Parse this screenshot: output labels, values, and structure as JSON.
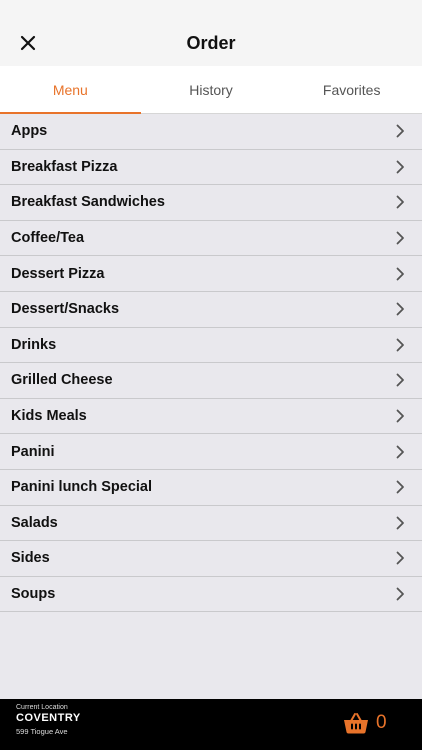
{
  "header": {
    "title": "Order",
    "close_icon": "close-icon"
  },
  "tabs": [
    {
      "label": "Menu",
      "active": true
    },
    {
      "label": "History",
      "active": false
    },
    {
      "label": "Favorites",
      "active": false
    }
  ],
  "menu": {
    "items": [
      {
        "label": "Apps"
      },
      {
        "label": "Breakfast Pizza"
      },
      {
        "label": "Breakfast Sandwiches"
      },
      {
        "label": "Coffee/Tea"
      },
      {
        "label": "Dessert Pizza"
      },
      {
        "label": "Dessert/Snacks"
      },
      {
        "label": "Drinks"
      },
      {
        "label": "Grilled Cheese"
      },
      {
        "label": "Kids Meals"
      },
      {
        "label": "Panini"
      },
      {
        "label": "Panini lunch Special"
      },
      {
        "label": "Salads"
      },
      {
        "label": "Sides"
      },
      {
        "label": "Soups"
      }
    ]
  },
  "footer": {
    "caption": "Current Location",
    "location_name": "COVENTRY",
    "address": "599 Tiogue Ave",
    "cart_count": "0"
  },
  "colors": {
    "accent": "#e8732a",
    "background": "#e9e8ed",
    "footer": "#000000"
  }
}
